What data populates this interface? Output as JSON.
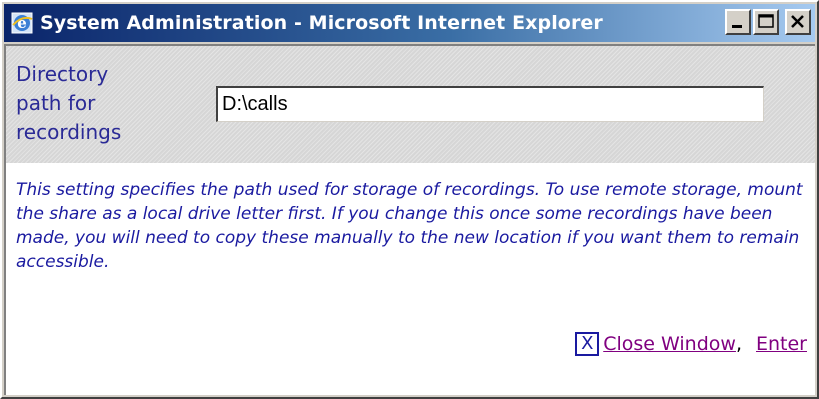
{
  "window": {
    "title": "System Administration - Microsoft Internet Explorer",
    "controls": [
      "minimize",
      "maximize",
      "close"
    ]
  },
  "setting": {
    "label": "Directory\npath for\nrecordings",
    "value": "D:\\calls"
  },
  "description": "This setting specifies the path used for storage of recordings. To use remote storage, mount the share as a local drive letter first. If you change this once some recordings have been made, you will need to copy these manually to the new location if you want them to remain accessible.",
  "actions": {
    "close_box_glyph": "X",
    "close_window_label": " Close Window",
    "separator": ",",
    "enter_label": "Enter"
  },
  "icons": {
    "title_icon": "internet-explorer-icon",
    "close_box": "x-box-icon"
  },
  "colors": {
    "title_bar_start": "#0a246a",
    "title_bar_end": "#a6caf0",
    "label_text": "#2a2a96",
    "description_text": "#1a1aa0",
    "visited_link": "#800080"
  }
}
